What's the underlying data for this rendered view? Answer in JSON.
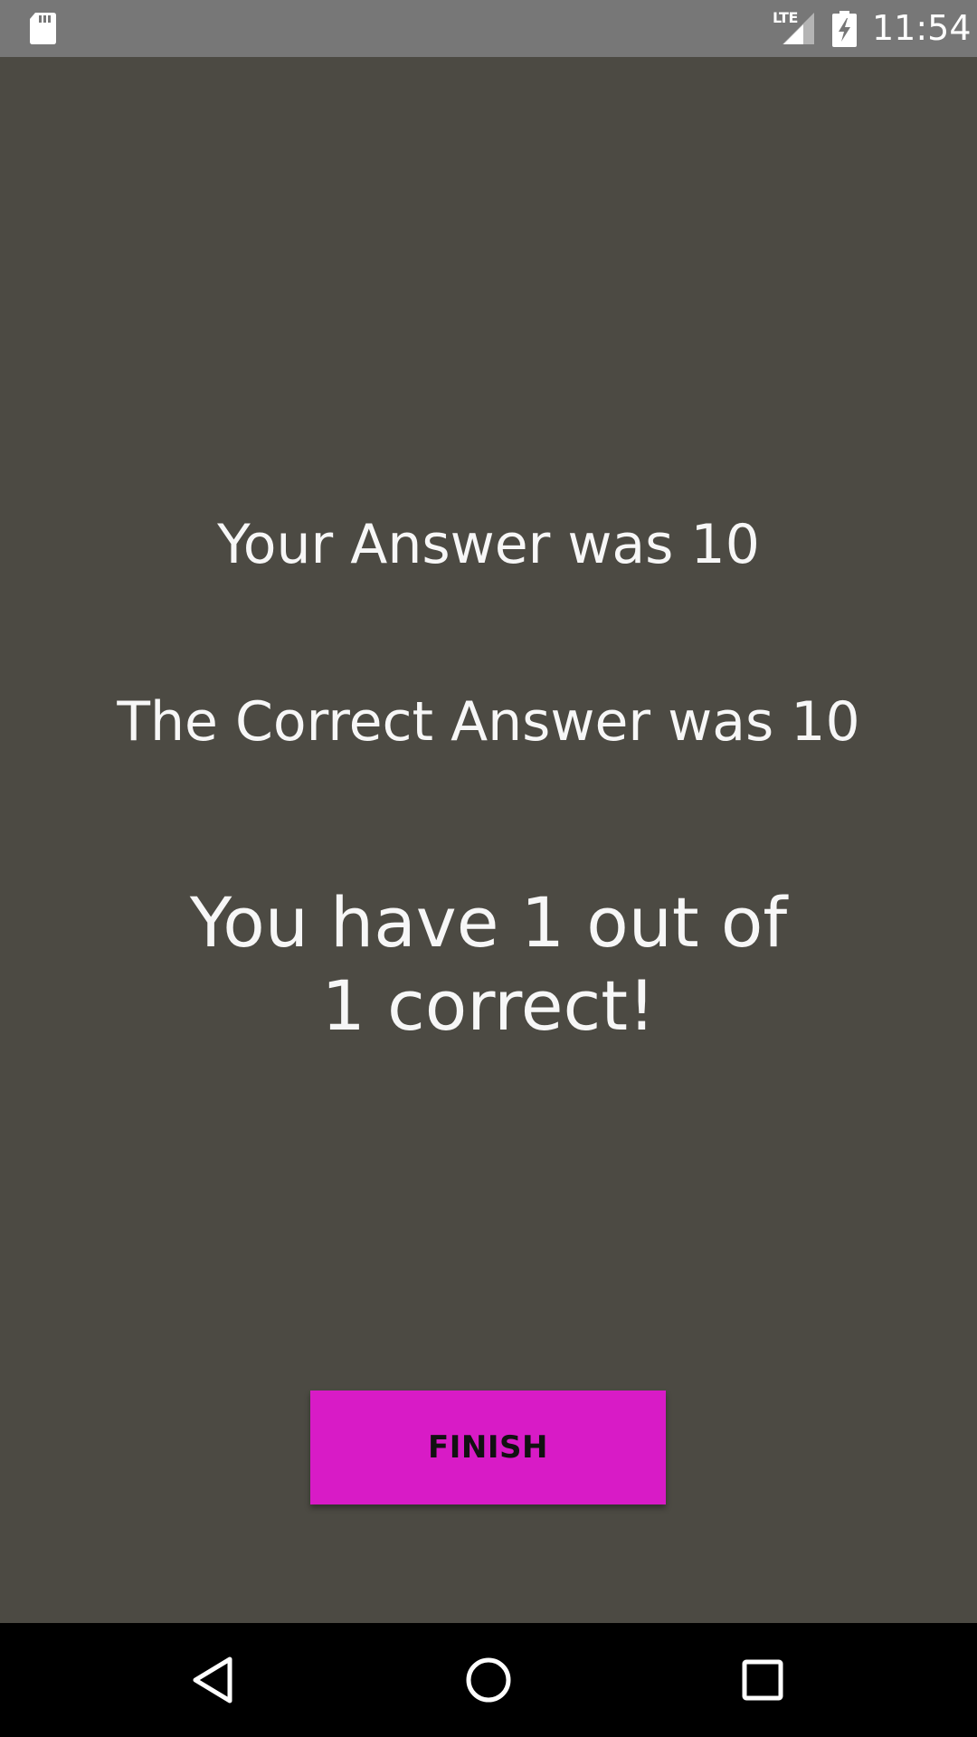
{
  "status_bar": {
    "time": "11:54",
    "network": "LTE",
    "icons": [
      "sd-card-icon",
      "lte-signal-icon",
      "battery-charging-icon"
    ]
  },
  "result": {
    "your_answer": "Your Answer was 10",
    "correct_answer": "The Correct Answer was 10",
    "score_line1": "You have 1 out of",
    "score_line2": "1 correct!"
  },
  "finish_button": {
    "label": "FINISH",
    "color": "#d81bc6"
  },
  "nav_bar": {
    "icons": [
      "back-icon",
      "home-icon",
      "recents-icon"
    ]
  },
  "colors": {
    "background": "#4c4a43",
    "status_bar": "#777777",
    "text": "#f7f7f7"
  }
}
